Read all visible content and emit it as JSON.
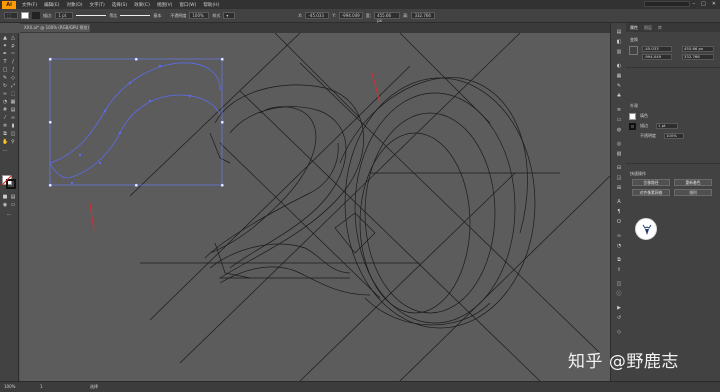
{
  "app": {
    "logo": "Ai"
  },
  "menubar": {
    "items": [
      "文件(F)",
      "编辑(E)",
      "对象(O)",
      "文字(T)",
      "选择(S)",
      "效果(C)",
      "视图(V)",
      "窗口(W)",
      "帮助(H)"
    ],
    "right_icons": [
      "minimize-icon",
      "maximize-icon",
      "close-icon"
    ]
  },
  "control": {
    "stroke_weight": "1 pt",
    "profile_label": "等比",
    "brush_label": "基本",
    "opacity_label": "不透明度",
    "opacity_value": "100%",
    "style_label": "样式",
    "x_value": "-45.033",
    "y_value": "-994.049",
    "w_value": "455.66 px",
    "h_value": "332.766"
  },
  "document": {
    "tab_title": "XXX.ai* @ 100% (RGB/GPU 预览)"
  },
  "panel": {
    "tabs": [
      "属性",
      "图层",
      "库"
    ],
    "section_transform": "变换",
    "x_value": "-45.033",
    "y_value": "-994.049",
    "w_value": "455.66 px",
    "h_value": "332.766",
    "section_appearance": "外观",
    "fill_label": "填色",
    "stroke_label": "描边",
    "stroke_value": "1 pt",
    "opacity_label": "不透明度",
    "opacity_value": "100%",
    "section_quick": "快速操作",
    "btn_offset": "位移路径",
    "btn_recolor": "重新着色",
    "btn_align": "对齐像素网格",
    "btn_arrange": "排列"
  },
  "status": {
    "zoom": "100%",
    "page": "1",
    "tool": "选择"
  },
  "watermark": "知乎 @野鹿志"
}
